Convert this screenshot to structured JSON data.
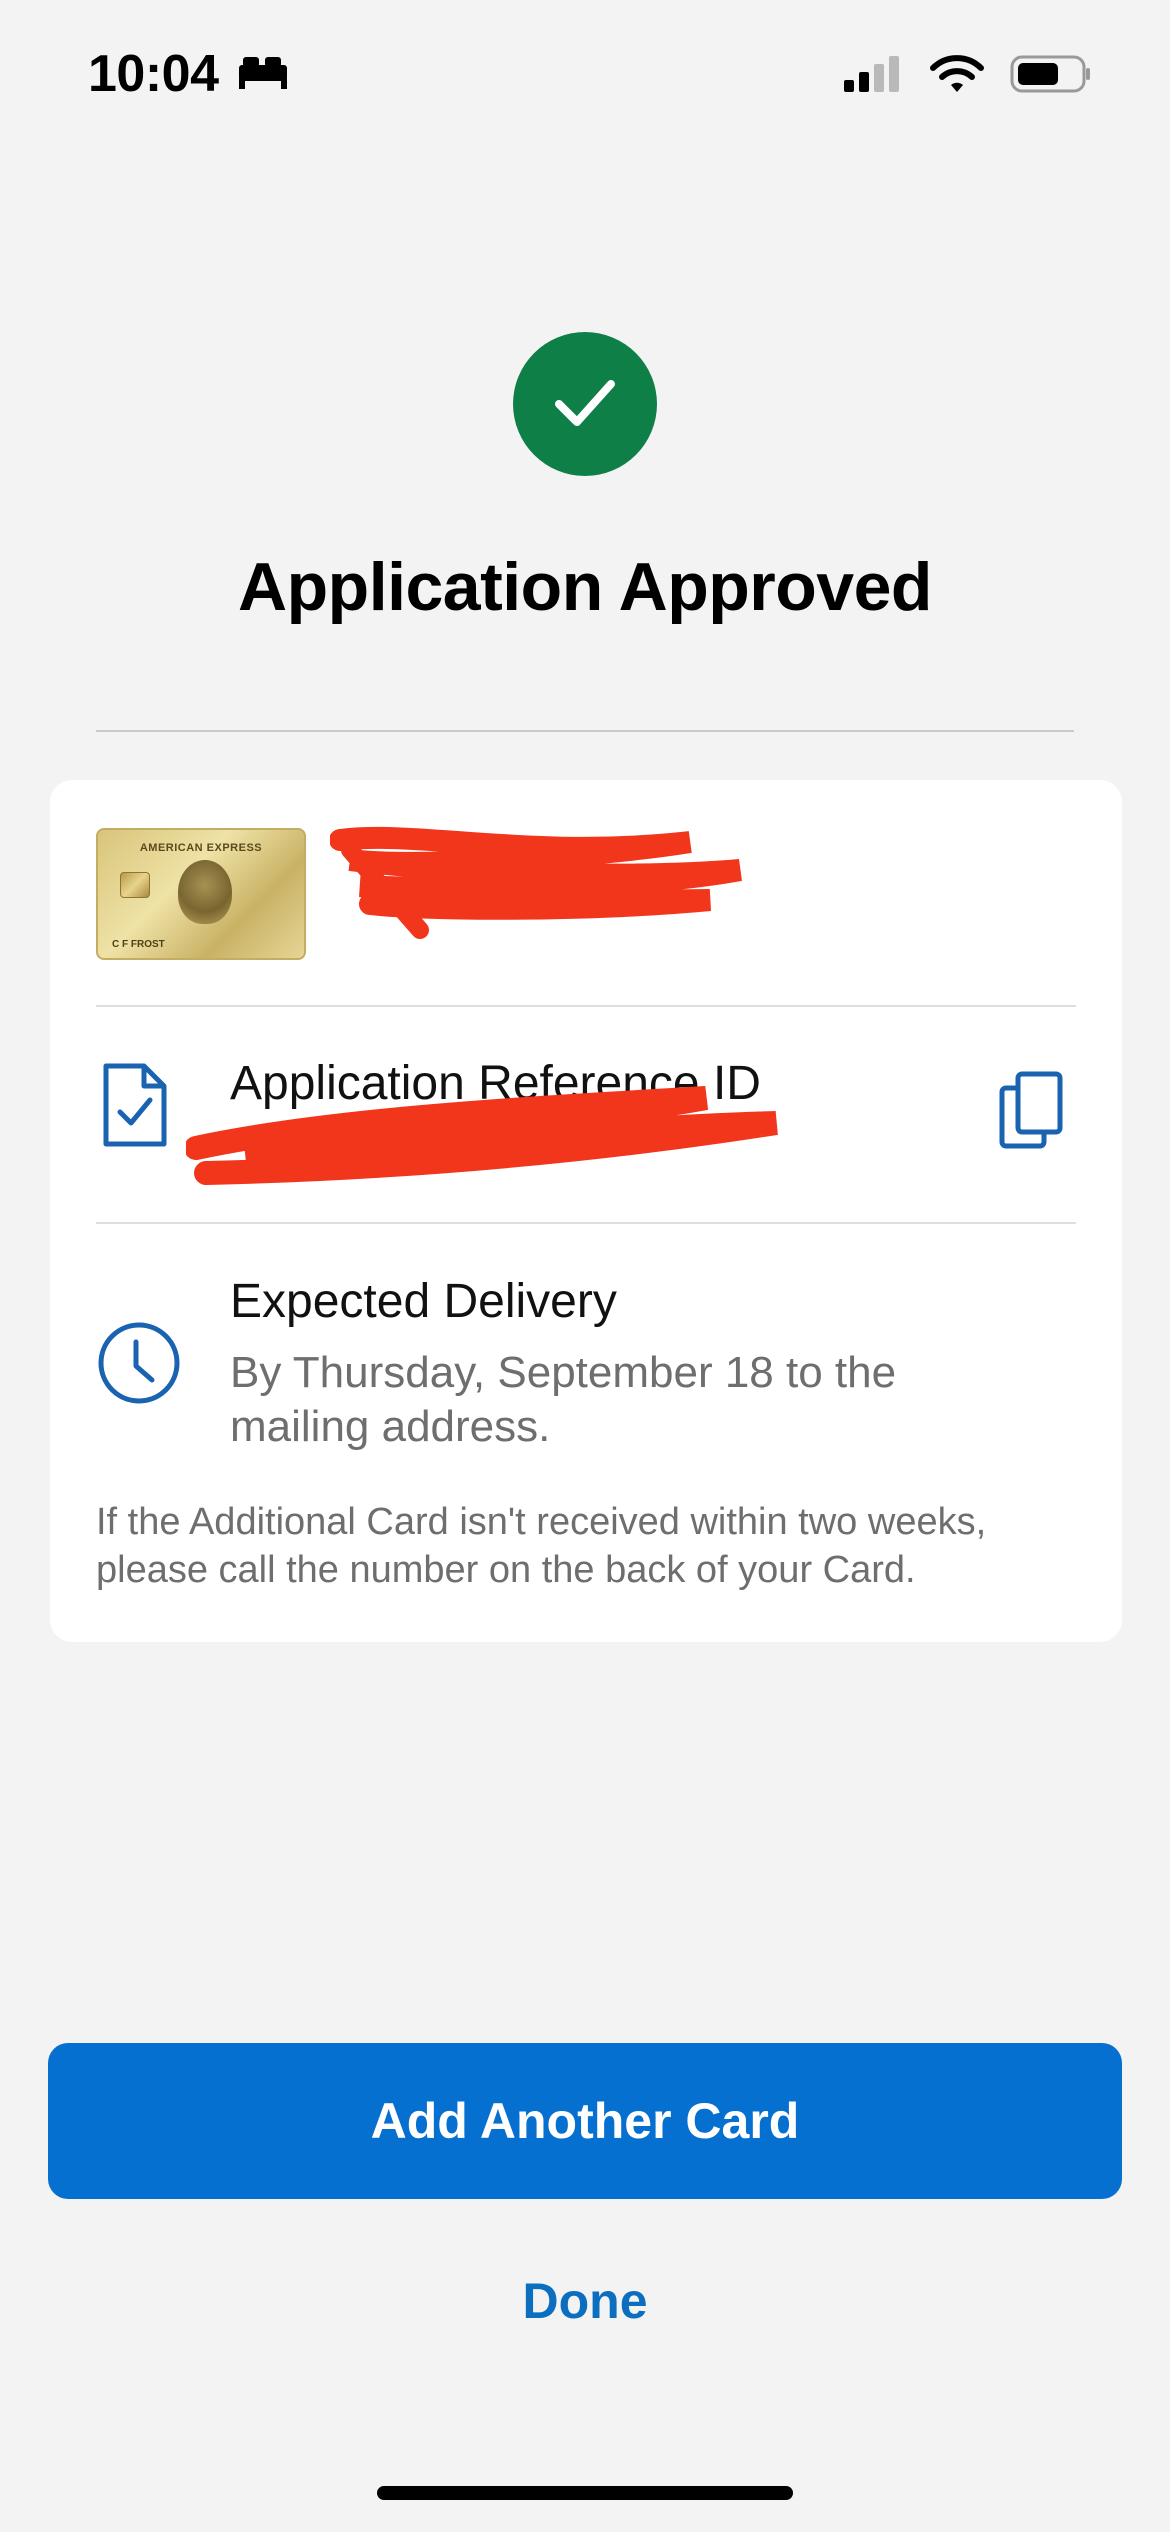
{
  "status_bar": {
    "time": "10:04",
    "sleep_icon": "bed-icon",
    "signal_icon": "cellular-signal-icon",
    "wifi_icon": "wifi-icon",
    "battery_icon": "battery-icon"
  },
  "header": {
    "status_icon": "checkmark-icon",
    "title": "Application Approved",
    "success_color": "#0f7f48"
  },
  "card_summary": {
    "card_image": {
      "brand_text": "AMERICAN EXPRESS",
      "holder_text": "C F FROST"
    },
    "card_name_redacted": true
  },
  "reference": {
    "icon": "document-check-icon",
    "label": "Application Reference ID",
    "value_redacted": true,
    "copy_icon": "copy-icon"
  },
  "delivery": {
    "icon": "clock-icon",
    "label": "Expected Delivery",
    "detail": "By Thursday, September 18 to the mailing address.",
    "note": "If the Additional Card isn't received within two weeks, please call the number on the back of your Card."
  },
  "actions": {
    "primary_label": "Add Another Card",
    "secondary_label": "Done",
    "accent_color": "#0670d1"
  }
}
